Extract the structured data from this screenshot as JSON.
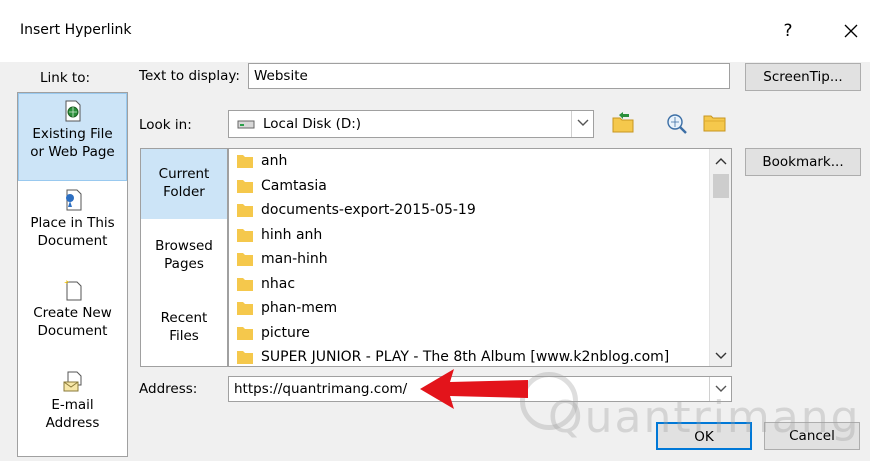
{
  "window": {
    "title": "Insert Hyperlink",
    "help_label": "?",
    "close_icon": "close-icon"
  },
  "link_to": {
    "label": "Link to:",
    "items": [
      {
        "line1": "Existing File",
        "line2": "or Web Page",
        "icon": "web-page-icon",
        "active": true
      },
      {
        "line1": "Place in This",
        "line2": "Document",
        "icon": "place-in-document-icon",
        "active": false
      },
      {
        "line1": "Create New",
        "line2": "Document",
        "icon": "new-document-icon",
        "active": false
      },
      {
        "line1": "E-mail",
        "line2": "Address",
        "icon": "email-icon",
        "active": false
      }
    ]
  },
  "text_to_display": {
    "label": "Text to display:",
    "value": "Website"
  },
  "buttons": {
    "screentip": "ScreenTip...",
    "bookmark": "Bookmark...",
    "ok": "OK",
    "cancel": "Cancel"
  },
  "look_in": {
    "label": "Look in:",
    "value": "Local Disk (D:)",
    "icon": "drive-icon"
  },
  "toolbar_icons": [
    "up-folder-icon",
    "browse-web-icon",
    "browse-file-icon"
  ],
  "places": [
    {
      "line1": "Current",
      "line2": "Folder",
      "active": true
    },
    {
      "line1": "Browsed",
      "line2": "Pages",
      "active": false
    },
    {
      "line1": "Recent",
      "line2": "Files",
      "active": false
    }
  ],
  "files": [
    "anh",
    "Camtasia",
    "documents-export-2015-05-19",
    "hinh anh",
    "man-hinh",
    "nhac",
    "phan-mem",
    "picture",
    "SUPER JUNIOR - PLAY - The 8th Album [www.k2nblog.com]"
  ],
  "address": {
    "label": "Address:",
    "value": "https://quantrimang.com/"
  },
  "watermark": "Quantrimang",
  "colors": {
    "selection": "#cce4f7",
    "folder": "#f5c84c",
    "arrow": "#e3141b"
  }
}
